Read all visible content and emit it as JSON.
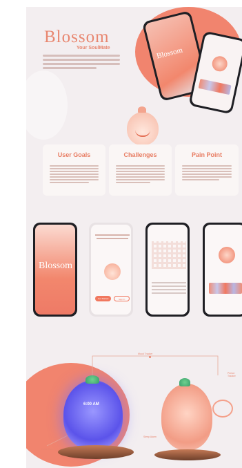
{
  "brand": {
    "name": "Blossom",
    "tagline": "Your SoulMate"
  },
  "sections": {
    "user_goals": "User Goals",
    "challenges": "Challenges",
    "pain_point": "Pain Point"
  },
  "phone_screens": {
    "splash_brand": "Blossom",
    "cta_primary": "Get Started",
    "cta_secondary": "Sign In"
  },
  "device": {
    "clock": "6:00 AM",
    "labels": {
      "mood_tracker": "Mood Tracker",
      "period_tracker": "Period Tracker",
      "sleep_alarm": "Sleep Alarm",
      "detail_face": "Detail Face"
    }
  },
  "colors": {
    "accent": "#e8866f",
    "petal": "#f1785f",
    "background": "#f3eef0"
  }
}
